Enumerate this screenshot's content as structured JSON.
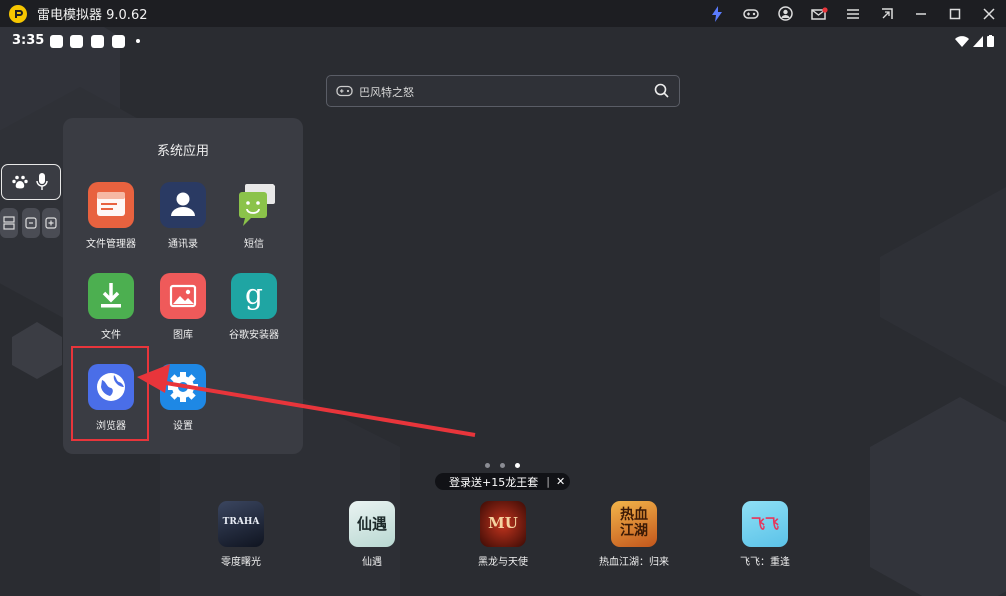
{
  "window": {
    "title": "雷电模拟器 9.0.62"
  },
  "status": {
    "time": "3:35"
  },
  "search": {
    "text": "巴风特之怒"
  },
  "folder": {
    "title": "系统应用",
    "apps": [
      {
        "label": "文件管理器",
        "icon": "file-manager-icon"
      },
      {
        "label": "通讯录",
        "icon": "contacts-icon"
      },
      {
        "label": "短信",
        "icon": "messages-icon"
      },
      {
        "label": "文件",
        "icon": "download-icon"
      },
      {
        "label": "图库",
        "icon": "gallery-icon"
      },
      {
        "label": "谷歌安装器",
        "icon": "google-installer-icon"
      },
      {
        "label": "浏览器",
        "icon": "browser-icon"
      },
      {
        "label": "设置",
        "icon": "settings-icon"
      }
    ]
  },
  "promo": {
    "text": "登录送+15龙王套",
    "close": "✕"
  },
  "dock": [
    {
      "label": "零度曙光",
      "icon": "traha-game-icon",
      "icon_text": "TRAHA"
    },
    {
      "label": "仙遇",
      "icon": "xianyu-game-icon",
      "icon_text": "仙遇"
    },
    {
      "label": "黑龙与天使",
      "icon": "mu-game-icon",
      "icon_text": "MU"
    },
    {
      "label": "热血江湖：归来",
      "icon": "rexue-game-icon",
      "icon_text": "热血江湖"
    },
    {
      "label": "飞飞：重逢",
      "icon": "feifei-game-icon",
      "icon_text": "飞飞"
    }
  ],
  "colors": {
    "accent_red": "#e8353b",
    "titlebar": "#1d1e22",
    "logo_yellow": "#f6c600"
  }
}
